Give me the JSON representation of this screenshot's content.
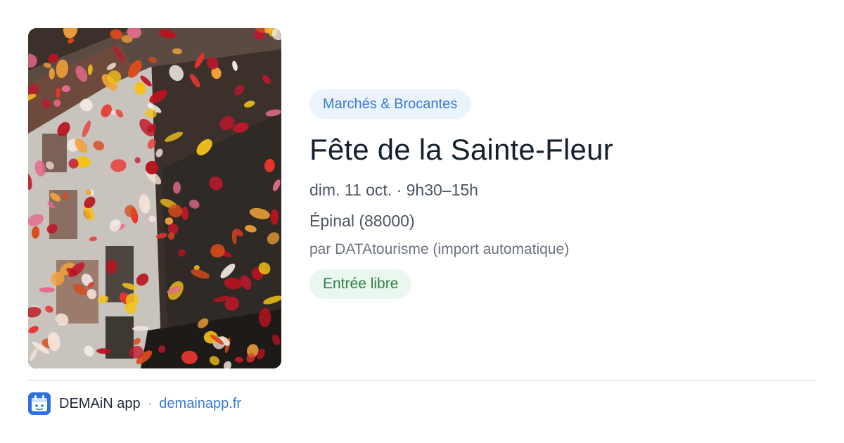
{
  "event": {
    "category": "Marchés & Brocantes",
    "title": "Fête de la Sainte-Fleur",
    "date": "dim. 11 oct. · 9h30–15h",
    "location": "Épinal (88000)",
    "source": "par DATAtourisme (import automatique)",
    "price": "Entrée libre",
    "image_icon": "flower-petals-photo"
  },
  "footer": {
    "app_name": "DEMAiN app",
    "separator": "·",
    "url": "demainapp.fr",
    "logo_icon": "demain-calendar-logo-icon"
  },
  "colors": {
    "accent": "#3a7bd5",
    "category_bg": "#ebf3fd",
    "price_text": "#2f7d47",
    "price_bg": "#eaf7ee",
    "title": "#15202e",
    "muted": "#4b5563"
  }
}
